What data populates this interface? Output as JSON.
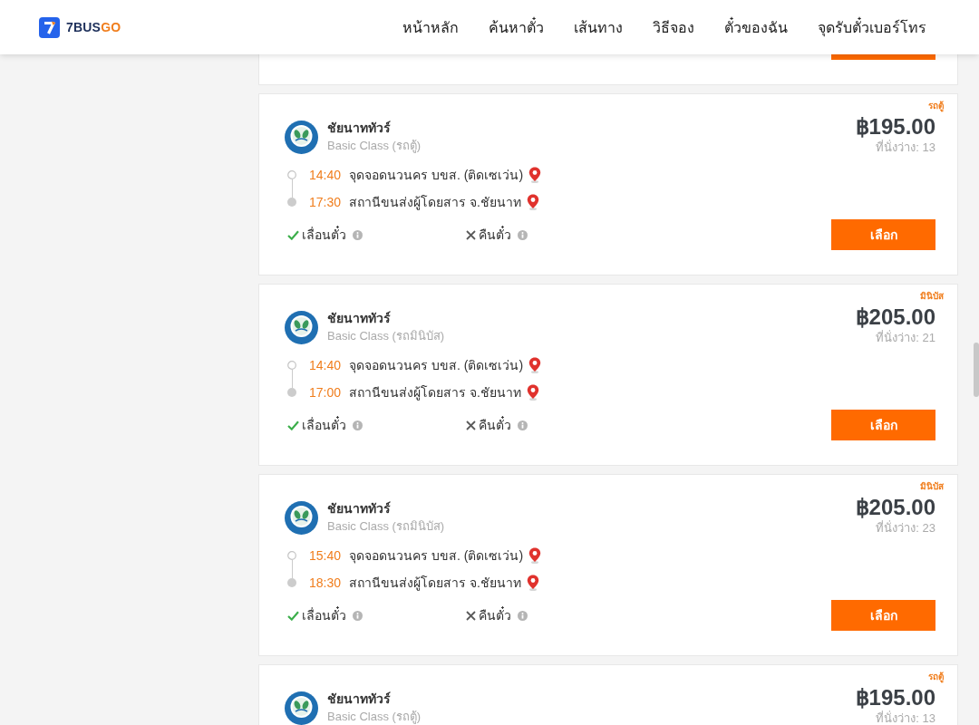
{
  "header": {
    "brand": {
      "main": "7BUS",
      "accent": "GO"
    },
    "nav": [
      "หน้าหลัก",
      "ค้นหาตั๋ว",
      "เส้นทาง",
      "วิธีจอง",
      "ตั๋วของฉัน",
      "จุดรับตั๋วเบอร์โทร"
    ]
  },
  "cards": [
    {
      "kind": "cut_off"
    },
    {
      "kind": "full",
      "badge": "รถตู้",
      "operator": "ชัยนาททัวร์",
      "class": "Basic Class (รถตู้)",
      "price": "฿195.00",
      "seats": "ที่นั่งว่าง: 13",
      "stops": [
        {
          "kind": "departure",
          "time": "14:40",
          "place": "จุดจอดนวนคร บขส. (ติดเซเว่น)"
        },
        {
          "kind": "arrival",
          "time": "17:30",
          "place": "สถานีขนส่งผู้โดยสาร จ.ชัยนาท"
        }
      ],
      "features": [
        {
          "label": "เลื่อนตั๋ว",
          "available": true
        },
        {
          "label": "คืนตั๋ว",
          "available": false
        }
      ],
      "button": "เลือก"
    },
    {
      "kind": "full",
      "badge": "มินิบัส",
      "operator": "ชัยนาททัวร์",
      "class": "Basic Class (รถมินิบัส)",
      "price": "฿205.00",
      "seats": "ที่นั่งว่าง: 21",
      "stops": [
        {
          "kind": "departure",
          "time": "14:40",
          "place": "จุดจอดนวนคร บขส. (ติดเซเว่น)"
        },
        {
          "kind": "arrival",
          "time": "17:00",
          "place": "สถานีขนส่งผู้โดยสาร จ.ชัยนาท"
        }
      ],
      "features": [
        {
          "label": "เลื่อนตั๋ว",
          "available": true
        },
        {
          "label": "คืนตั๋ว",
          "available": false
        }
      ],
      "button": "เลือก"
    },
    {
      "kind": "full",
      "badge": "มินิบัส",
      "operator": "ชัยนาททัวร์",
      "class": "Basic Class (รถมินิบัส)",
      "price": "฿205.00",
      "seats": "ที่นั่งว่าง: 23",
      "stops": [
        {
          "kind": "departure",
          "time": "15:40",
          "place": "จุดจอดนวนคร บขส. (ติดเซเว่น)"
        },
        {
          "kind": "arrival",
          "time": "18:30",
          "place": "สถานีขนส่งผู้โดยสาร จ.ชัยนาท"
        }
      ],
      "features": [
        {
          "label": "เลื่อนตั๋ว",
          "available": true
        },
        {
          "label": "คืนตั๋ว",
          "available": false
        }
      ],
      "button": "เลือก"
    },
    {
      "kind": "full",
      "badge": "รถตู้",
      "operator": "ชัยนาททัวร์",
      "class": "Basic Class (รถตู้)",
      "price": "฿195.00",
      "seats": "ที่นั่งว่าง: 13"
    }
  ]
}
